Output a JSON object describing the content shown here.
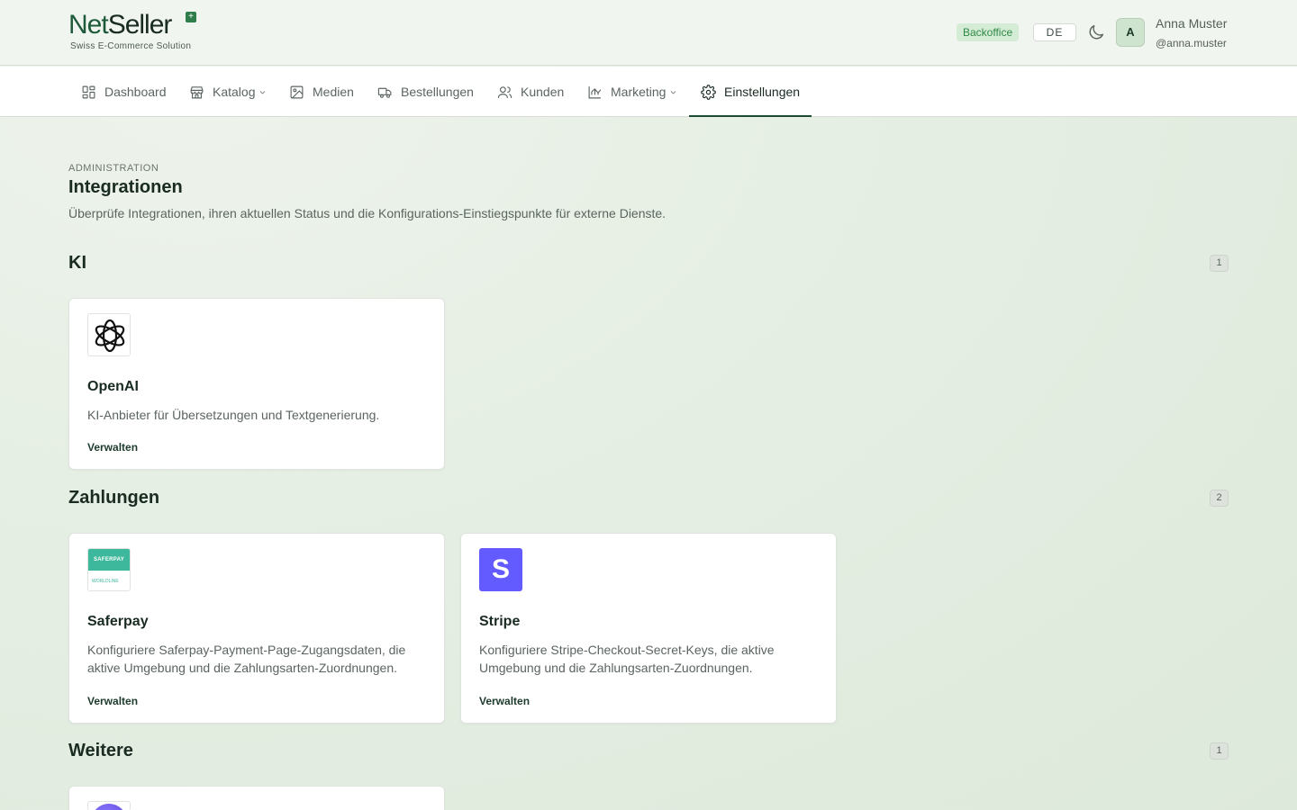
{
  "brand": {
    "name_part1": "Net",
    "name_part2": "Seller",
    "tagline": "Swiss E-Commerce Solution",
    "accent_color": "#1d4a33"
  },
  "header": {
    "badge": "Backoffice",
    "language": "DE",
    "theme_icon": "moon-icon",
    "user": {
      "initial": "A",
      "name": "Anna Muster",
      "handle": "@anna.muster"
    }
  },
  "nav": {
    "items": [
      {
        "label": "Dashboard",
        "icon": "dashboard-icon"
      },
      {
        "label": "Katalog",
        "icon": "store-icon"
      },
      {
        "label": "Medien",
        "icon": "image-icon"
      },
      {
        "label": "Bestellungen",
        "icon": "truck-icon"
      },
      {
        "label": "Kunden",
        "icon": "users-icon"
      },
      {
        "label": "Marketing",
        "icon": "chart-icon"
      },
      {
        "label": "Einstellungen",
        "icon": "gear-icon"
      }
    ],
    "active": "Einstellungen"
  },
  "page": {
    "kicker": "ADMINISTRATION",
    "title": "Integrationen",
    "description": "Überprüfe Integrationen, ihren aktuellen Status und die Konfigurations-Einstiegspunkte für externe Dienste."
  },
  "sections": [
    {
      "title": "KI",
      "count": "1",
      "cards": [
        {
          "title": "OpenAI",
          "description": "KI-Anbieter für Übersetzungen und Textgenerierung.",
          "action": "Verwalten",
          "logo": "openai-logo"
        }
      ]
    },
    {
      "title": "Zahlungen",
      "count": "2",
      "cards": [
        {
          "title": "Saferpay",
          "description": "Konfiguriere Saferpay-Payment-Page-Zugangsdaten, die aktive Umgebung und die Zahlungsarten-Zuordnungen.",
          "action": "Verwalten",
          "logo": "saferpay-logo",
          "logo_text_top": "SAFERPAY",
          "logo_text_bottom": "WORLDLINE"
        },
        {
          "title": "Stripe",
          "description": "Konfiguriere Stripe-Checkout-Secret-Keys, die aktive Umgebung und die Zahlungsarten-Zuordnungen.",
          "action": "Verwalten",
          "logo": "stripe-logo",
          "logo_letter": "S"
        }
      ]
    },
    {
      "title": "Weitere",
      "count": "1",
      "cards": []
    }
  ]
}
